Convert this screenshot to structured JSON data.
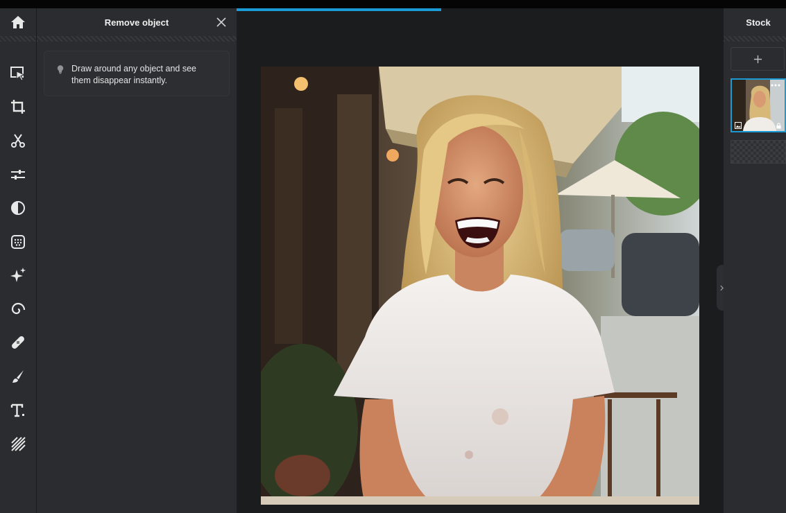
{
  "panel": {
    "title": "Remove object",
    "tip": "Draw around any object and see them disappear instantly."
  },
  "right_panel": {
    "title": "Stock"
  },
  "progress": {
    "fraction": 0.42
  },
  "tools": [
    {
      "name": "select-tool",
      "icon": "select-arrow-icon"
    },
    {
      "name": "crop-tool",
      "icon": "crop-icon"
    },
    {
      "name": "cut-tool",
      "icon": "scissors-icon"
    },
    {
      "name": "adjust-tool",
      "icon": "sliders-icon"
    },
    {
      "name": "filter-tool",
      "icon": "half-circle-icon"
    },
    {
      "name": "texture-tool",
      "icon": "dots-grid-icon"
    },
    {
      "name": "ai-tool",
      "icon": "sparkle-icon"
    },
    {
      "name": "swirl-tool",
      "icon": "spiral-icon"
    },
    {
      "name": "heal-tool",
      "icon": "bandage-icon"
    },
    {
      "name": "brush-tool",
      "icon": "brush-icon"
    },
    {
      "name": "text-tool",
      "icon": "text-icon"
    },
    {
      "name": "pattern-tool",
      "icon": "diagonal-lines-icon"
    }
  ],
  "colors": {
    "accent": "#1b9bd6",
    "panel": "#2a2c2f",
    "canvas": "#1b1c1e"
  }
}
